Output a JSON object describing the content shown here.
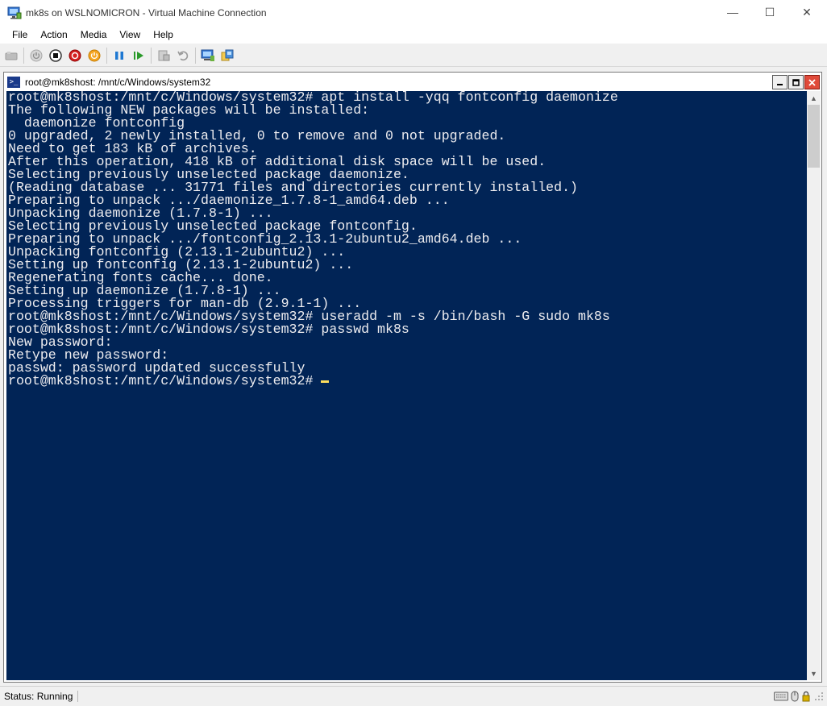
{
  "window": {
    "title": "mk8s on WSLNOMICRON - Virtual Machine Connection",
    "minimize_glyph": "—",
    "maximize_glyph": "☐",
    "close_glyph": "✕"
  },
  "menu": {
    "file": "File",
    "action": "Action",
    "media": "Media",
    "view": "View",
    "help": "Help"
  },
  "toolbar": {
    "icons": [
      "ctrl-alt-del-icon",
      "start-icon",
      "turn-off-icon",
      "shut-down-icon",
      "save-icon",
      "pause-icon",
      "reset-icon",
      "checkpoint-icon",
      "revert-icon",
      "enhanced-session-icon",
      "share-icon"
    ]
  },
  "console": {
    "title": "root@mk8shost: /mnt/c/Windows/system32",
    "lines": [
      "root@mk8shost:/mnt/c/Windows/system32# apt install -yqq fontconfig daemonize",
      "The following NEW packages will be installed:",
      "  daemonize fontconfig",
      "0 upgraded, 2 newly installed, 0 to remove and 0 not upgraded.",
      "Need to get 183 kB of archives.",
      "After this operation, 418 kB of additional disk space will be used.",
      "Selecting previously unselected package daemonize.",
      "(Reading database ... 31771 files and directories currently installed.)",
      "Preparing to unpack .../daemonize_1.7.8-1_amd64.deb ...",
      "Unpacking daemonize (1.7.8-1) ...",
      "Selecting previously unselected package fontconfig.",
      "Preparing to unpack .../fontconfig_2.13.1-2ubuntu2_amd64.deb ...",
      "Unpacking fontconfig (2.13.1-2ubuntu2) ...",
      "Setting up fontconfig (2.13.1-2ubuntu2) ...",
      "Regenerating fonts cache... done.",
      "Setting up daemonize (1.7.8-1) ...",
      "Processing triggers for man-db (2.9.1-1) ...",
      "root@mk8shost:/mnt/c/Windows/system32# useradd -m -s /bin/bash -G sudo mk8s",
      "root@mk8shost:/mnt/c/Windows/system32# passwd mk8s",
      "New password:",
      "Retype new password:",
      "passwd: password updated successfully"
    ],
    "prompt": "root@mk8shost:/mnt/c/Windows/system32# ",
    "colors": {
      "background": "#012456",
      "foreground": "#eeedf0",
      "cursor": "#fede5d"
    }
  },
  "status": {
    "text": "Status: Running"
  }
}
